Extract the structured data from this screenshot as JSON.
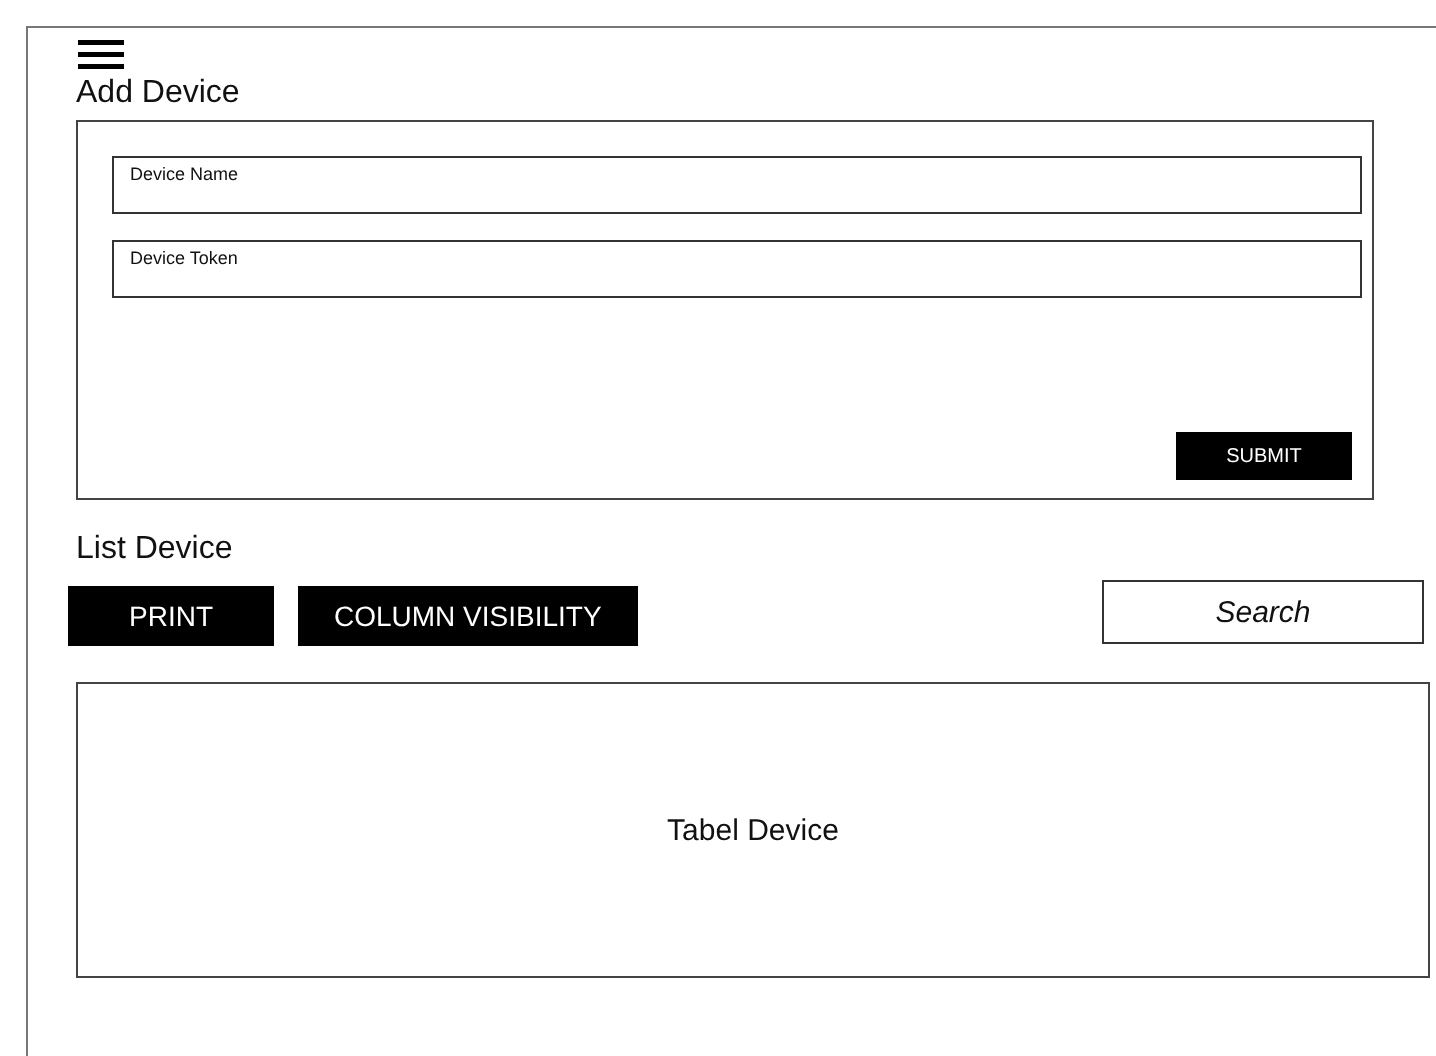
{
  "add_section": {
    "title": "Add Device",
    "fields": [
      {
        "placeholder": "Device Name"
      },
      {
        "placeholder": "Device Token"
      }
    ],
    "submit": "SUBMIT"
  },
  "list_section": {
    "title": "List Device",
    "buttons": [
      "PRINT",
      "COLUMN VISIBILITY"
    ],
    "search": {
      "placeholder": "Search"
    },
    "table": {
      "label": "Tabel Device"
    }
  }
}
